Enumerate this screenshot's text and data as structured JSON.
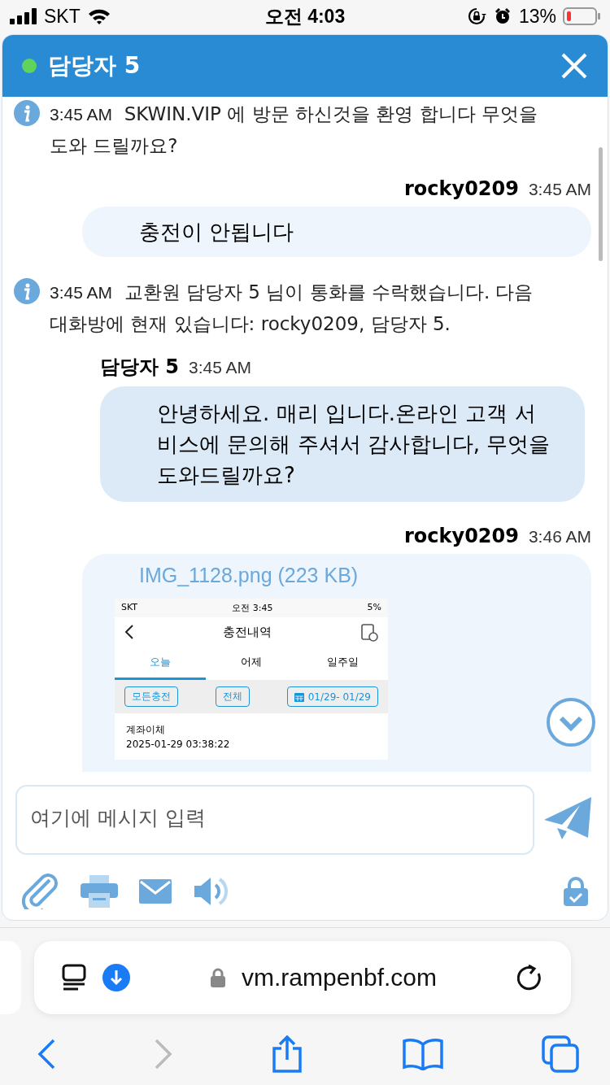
{
  "status_bar": {
    "carrier": "SKT",
    "time": "오전 4:03",
    "battery": "13%"
  },
  "chat_header": {
    "title": "담당자 5",
    "online": true
  },
  "messages": [
    {
      "kind": "system",
      "time": "3:45 AM",
      "text": "SKWIN.VIP 에 방문 하신것을 환영 합니다 무엇을 도와 드릴까요?"
    },
    {
      "kind": "outgoing",
      "sender": "rocky0209",
      "time": "3:45 AM",
      "text": "충전이 안됩니다"
    },
    {
      "kind": "system",
      "time": "3:45 AM",
      "text": "교환원 담당자 5 님이 통화를 수락했습니다. 다음 대화방에 현재 있습니다: rocky0209, 담당자 5."
    },
    {
      "kind": "incoming",
      "sender": "담당자 5",
      "time": "3:45 AM",
      "text": "안녕하세요. 매리 입니다.온라인 고객 서비스에 문의해 주셔서 감사합니다, 무엇을 도와드릴까요?"
    },
    {
      "kind": "file",
      "sender": "rocky0209",
      "time": "3:46 AM",
      "file_name": "IMG_1128.png (223 KB)",
      "attachment": {
        "carrier": "SKT",
        "time": "오전 3:45",
        "battery": "5%",
        "title": "충전내역",
        "tabs": [
          {
            "label": "오늘",
            "selected": true
          },
          {
            "label": "어제",
            "selected": false
          },
          {
            "label": "일주일",
            "selected": false
          }
        ],
        "filters": [
          "모든충전",
          "전체"
        ],
        "date_range": "01/29- 01/29",
        "entry_title": "계좌이체",
        "entry_date": "2025-01-29 03:38:22"
      }
    }
  ],
  "composer": {
    "placeholder": "여기에 메시지 입력"
  },
  "browser": {
    "url": "vm.rampenbf.com",
    "back_enabled": true,
    "forward_enabled": false
  }
}
